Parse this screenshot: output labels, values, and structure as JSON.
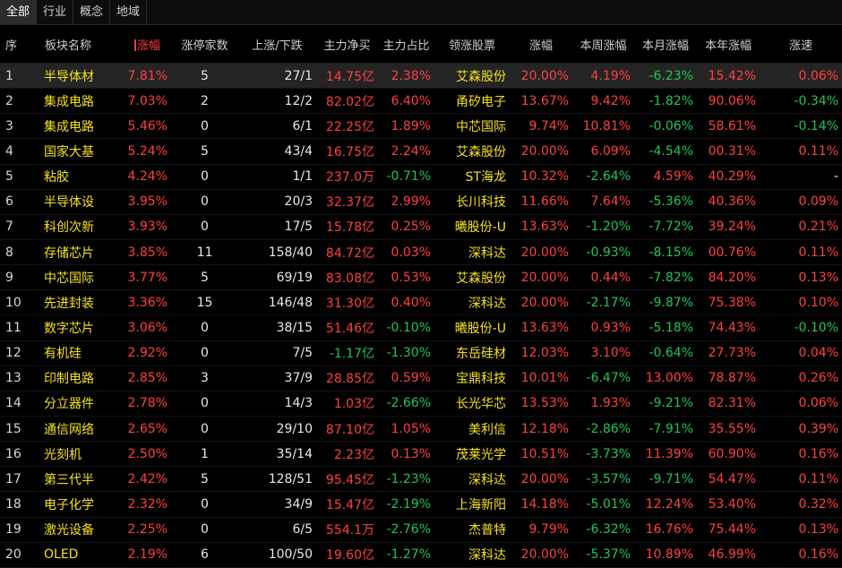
{
  "tabs": [
    "全部",
    "行业",
    "概念",
    "地域"
  ],
  "active_tab": 0,
  "columns": [
    "序",
    "板块名称",
    "涨幅",
    "涨停家数",
    "上涨/下跌",
    "主力净买",
    "主力占比",
    "领涨股票",
    "涨幅",
    "本周涨幅",
    "本月涨幅",
    "本年涨幅",
    "涨速"
  ],
  "sort_column": 2,
  "colors": {
    "up": "#ff4040",
    "down": "#22c35a",
    "name": "#f5e21b"
  },
  "rows": [
    {
      "idx": "1",
      "name": "半导体材",
      "chg": "7.81%",
      "limit": "5",
      "updown": "27/1",
      "net": "14.75亿",
      "ratio": "2.38%",
      "leader": "艾森股份",
      "lchg": "20.00%",
      "week": "4.19%",
      "month": "-6.23%",
      "year": "15.42%",
      "speed": "0.06%"
    },
    {
      "idx": "2",
      "name": "集成电路",
      "chg": "7.03%",
      "limit": "2",
      "updown": "12/2",
      "net": "82.02亿",
      "ratio": "6.40%",
      "leader": "甬矽电子",
      "lchg": "13.67%",
      "week": "9.42%",
      "month": "-1.82%",
      "year": "90.06%",
      "speed": "-0.34%"
    },
    {
      "idx": "3",
      "name": "集成电路",
      "chg": "5.46%",
      "limit": "0",
      "updown": "6/1",
      "net": "22.25亿",
      "ratio": "1.89%",
      "leader": "中芯国际",
      "lchg": "9.74%",
      "week": "10.81%",
      "month": "-0.06%",
      "year": "58.61%",
      "speed": "-0.14%"
    },
    {
      "idx": "4",
      "name": "国家大基",
      "chg": "5.24%",
      "limit": "5",
      "updown": "43/4",
      "net": "16.75亿",
      "ratio": "2.24%",
      "leader": "艾森股份",
      "lchg": "20.00%",
      "week": "6.09%",
      "month": "-4.54%",
      "year": "00.31%",
      "speed": "0.11%"
    },
    {
      "idx": "5",
      "name": "粘胶",
      "chg": "4.24%",
      "limit": "0",
      "updown": "1/1",
      "net": "237.0万",
      "ratio": "-0.71%",
      "leader": "ST海龙",
      "lchg": "10.32%",
      "week": "-2.64%",
      "month": "4.59%",
      "year": "40.29%",
      "speed": "-"
    },
    {
      "idx": "6",
      "name": "半导体设",
      "chg": "3.95%",
      "limit": "0",
      "updown": "20/3",
      "net": "32.37亿",
      "ratio": "2.99%",
      "leader": "长川科技",
      "lchg": "11.66%",
      "week": "7.64%",
      "month": "-5.36%",
      "year": "40.36%",
      "speed": "0.09%"
    },
    {
      "idx": "7",
      "name": "科创次新",
      "chg": "3.93%",
      "limit": "0",
      "updown": "17/5",
      "net": "15.78亿",
      "ratio": "0.25%",
      "leader": "曦股份-U",
      "lchg": "13.63%",
      "week": "-1.20%",
      "month": "-7.72%",
      "year": "39.24%",
      "speed": "0.21%"
    },
    {
      "idx": "8",
      "name": "存储芯片",
      "chg": "3.85%",
      "limit": "11",
      "updown": "158/40",
      "net": "84.72亿",
      "ratio": "0.03%",
      "leader": "深科达",
      "lchg": "20.00%",
      "week": "-0.93%",
      "month": "-8.15%",
      "year": "00.76%",
      "speed": "0.11%"
    },
    {
      "idx": "9",
      "name": "中芯国际",
      "chg": "3.77%",
      "limit": "5",
      "updown": "69/19",
      "net": "83.08亿",
      "ratio": "0.53%",
      "leader": "艾森股份",
      "lchg": "20.00%",
      "week": "0.44%",
      "month": "-7.82%",
      "year": "84.20%",
      "speed": "0.13%"
    },
    {
      "idx": "10",
      "name": "先进封装",
      "chg": "3.36%",
      "limit": "15",
      "updown": "146/48",
      "net": "31.30亿",
      "ratio": "0.40%",
      "leader": "深科达",
      "lchg": "20.00%",
      "week": "-2.17%",
      "month": "-9.87%",
      "year": "75.38%",
      "speed": "0.10%"
    },
    {
      "idx": "11",
      "name": "数字芯片",
      "chg": "3.06%",
      "limit": "0",
      "updown": "38/15",
      "net": "51.46亿",
      "ratio": "-0.10%",
      "leader": "曦股份-U",
      "lchg": "13.63%",
      "week": "0.93%",
      "month": "-5.18%",
      "year": "74.43%",
      "speed": "-0.10%"
    },
    {
      "idx": "12",
      "name": "有机硅",
      "chg": "2.92%",
      "limit": "0",
      "updown": "7/5",
      "net": "-1.17亿",
      "ratio": "-1.30%",
      "leader": "东岳硅材",
      "lchg": "12.03%",
      "week": "3.10%",
      "month": "-0.64%",
      "year": "27.73%",
      "speed": "0.04%"
    },
    {
      "idx": "13",
      "name": "印制电路",
      "chg": "2.85%",
      "limit": "3",
      "updown": "37/9",
      "net": "28.85亿",
      "ratio": "0.59%",
      "leader": "宝鼎科技",
      "lchg": "10.01%",
      "week": "-6.47%",
      "month": "13.00%",
      "year": "78.87%",
      "speed": "0.26%"
    },
    {
      "idx": "14",
      "name": "分立器件",
      "chg": "2.78%",
      "limit": "0",
      "updown": "14/3",
      "net": "1.03亿",
      "ratio": "-2.66%",
      "leader": "长光华芯",
      "lchg": "13.53%",
      "week": "1.93%",
      "month": "-9.21%",
      "year": "82.31%",
      "speed": "0.06%"
    },
    {
      "idx": "15",
      "name": "通信网络",
      "chg": "2.65%",
      "limit": "0",
      "updown": "29/10",
      "net": "87.10亿",
      "ratio": "1.05%",
      "leader": "美利信",
      "lchg": "12.18%",
      "week": "-2.86%",
      "month": "-7.91%",
      "year": "35.55%",
      "speed": "0.39%"
    },
    {
      "idx": "16",
      "name": "光刻机",
      "chg": "2.50%",
      "limit": "1",
      "updown": "35/14",
      "net": "2.23亿",
      "ratio": "0.13%",
      "leader": "茂莱光学",
      "lchg": "10.51%",
      "week": "-3.73%",
      "month": "11.39%",
      "year": "60.90%",
      "speed": "0.16%"
    },
    {
      "idx": "17",
      "name": "第三代半",
      "chg": "2.42%",
      "limit": "5",
      "updown": "128/51",
      "net": "95.45亿",
      "ratio": "-1.23%",
      "leader": "深科达",
      "lchg": "20.00%",
      "week": "-3.57%",
      "month": "-9.71%",
      "year": "54.47%",
      "speed": "0.11%"
    },
    {
      "idx": "18",
      "name": "电子化学",
      "chg": "2.32%",
      "limit": "0",
      "updown": "34/9",
      "net": "15.47亿",
      "ratio": "-2.19%",
      "leader": "上海新阳",
      "lchg": "14.18%",
      "week": "-5.01%",
      "month": "12.24%",
      "year": "53.40%",
      "speed": "0.32%"
    },
    {
      "idx": "19",
      "name": "激光设备",
      "chg": "2.25%",
      "limit": "0",
      "updown": "6/5",
      "net": "554.1万",
      "ratio": "-2.76%",
      "leader": "杰普特",
      "lchg": "9.79%",
      "week": "-6.32%",
      "month": "16.76%",
      "year": "75.44%",
      "speed": "0.13%"
    },
    {
      "idx": "20",
      "name": "OLED",
      "chg": "2.19%",
      "limit": "6",
      "updown": "100/50",
      "net": "19.60亿",
      "ratio": "-1.27%",
      "leader": "深科达",
      "lchg": "20.00%",
      "week": "-5.37%",
      "month": "10.89%",
      "year": "46.99%",
      "speed": "0.16%"
    }
  ]
}
